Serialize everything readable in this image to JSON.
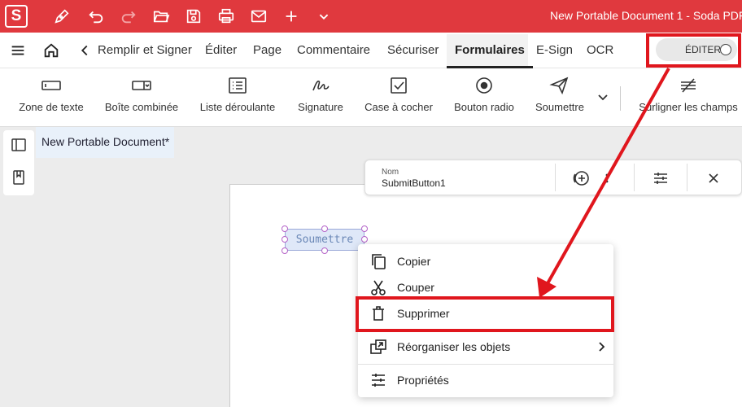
{
  "app": {
    "logo": "S",
    "title": "New Portable Document 1  -  Soda PDF",
    "brand_color": "#e0393e"
  },
  "titlebar": {
    "icons": [
      "pen-icon",
      "undo-icon",
      "redo-icon",
      "open-folder-icon",
      "save-icon",
      "print-icon",
      "email-icon",
      "plus-icon",
      "chevron-down-icon"
    ]
  },
  "menubar": {
    "items": [
      {
        "label": "Remplir et Signer"
      },
      {
        "label": "Éditer"
      },
      {
        "label": "Page"
      },
      {
        "label": "Commentaire"
      },
      {
        "label": "Sécuriser"
      },
      {
        "label": "Formulaires",
        "active": true
      },
      {
        "label": "E-Sign"
      },
      {
        "label": "OCR"
      }
    ],
    "edit_toggle": {
      "label": "ÉDITER",
      "state": "off"
    }
  },
  "ribbon": {
    "tools": [
      {
        "label": "Zone de texte",
        "icon": "text-field-icon"
      },
      {
        "label": "Boîte combinée",
        "icon": "combo-box-icon"
      },
      {
        "label": "Liste déroulante",
        "icon": "list-box-icon"
      },
      {
        "label": "Signature",
        "icon": "signature-icon"
      },
      {
        "label": "Case à cocher",
        "icon": "checkbox-icon"
      },
      {
        "label": "Bouton radio",
        "icon": "radio-button-icon"
      },
      {
        "label": "Soumettre",
        "icon": "submit-icon"
      },
      {
        "label": "Surligner les champs",
        "icon": "highlight-fields-icon"
      }
    ]
  },
  "document": {
    "tab_title": "New Portable Document*"
  },
  "field_bar": {
    "name_label": "Nom",
    "name_value": "SubmitButton1"
  },
  "field": {
    "label": "Soumettre"
  },
  "context_menu": {
    "items": [
      {
        "label": "Copier",
        "icon": "copy-icon"
      },
      {
        "label": "Couper",
        "icon": "cut-icon"
      },
      {
        "label": "Supprimer",
        "icon": "trash-icon",
        "highlighted": true
      },
      {
        "label": "Réorganiser les objets",
        "icon": "arrange-icon",
        "has_submenu": true
      },
      {
        "label": "Propriétés",
        "icon": "properties-icon"
      }
    ]
  },
  "annotation_color": "#e0161d"
}
